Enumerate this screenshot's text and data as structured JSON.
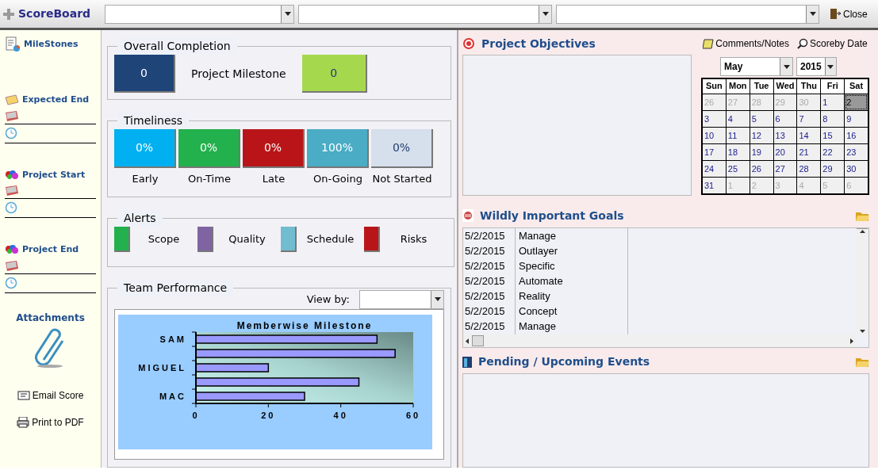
{
  "header": {
    "title": "ScoreBoard",
    "close": "Close"
  },
  "sidebar": {
    "heading": "MileStones",
    "sections": [
      {
        "label": "Expected End"
      },
      {
        "label": "Project Start"
      },
      {
        "label": "Project End"
      }
    ],
    "attachments": "Attachments",
    "actions": [
      {
        "kind": "email",
        "label": "Email Score"
      },
      {
        "kind": "print",
        "label": "Print to PDF"
      }
    ]
  },
  "overall": {
    "title": "Overall Completion",
    "value": "0",
    "milestone_label": "Project Milestone",
    "milestone_value": "0"
  },
  "timeliness": {
    "title": "Timeliness",
    "tiles": [
      {
        "value": "0%",
        "label": "Early",
        "color": "#00b0f0"
      },
      {
        "value": "0%",
        "label": "On-Time",
        "color": "#22b14c"
      },
      {
        "value": "0%",
        "label": "Late",
        "color": "#b91518"
      },
      {
        "value": "100%",
        "label": "On-Going",
        "color": "#4aacc5"
      },
      {
        "value": "0%",
        "label": "Not Started",
        "color": "#d6dfec"
      }
    ]
  },
  "alerts": {
    "title": "Alerts",
    "items": [
      {
        "label": "Scope",
        "color": "#22b14c"
      },
      {
        "label": "Quality",
        "color": "#8064a2"
      },
      {
        "label": "Schedule",
        "color": "#72bccf"
      },
      {
        "label": "Risks",
        "color": "#b91518"
      }
    ]
  },
  "team": {
    "title": "Team Performance",
    "view_by": "View by:",
    "chart_data": {
      "type": "bar",
      "orientation": "horizontal",
      "title": "Memberwise Milestone",
      "categories": [
        "SAM",
        null,
        "MIGUEL",
        null,
        "MAC"
      ],
      "series": [
        {
          "color": "#9999ff",
          "values": [
            50,
            55,
            20,
            45,
            30
          ]
        }
      ],
      "xlim": [
        0,
        60
      ],
      "xticks": [
        0,
        20,
        40,
        60
      ]
    }
  },
  "objectives": {
    "title": "Project Objectives",
    "links": [
      {
        "kind": "notes",
        "label": "Comments/Notes"
      },
      {
        "kind": "search",
        "label": "Scoreby Date"
      }
    ]
  },
  "calendar": {
    "month": "May",
    "year": "2015",
    "weekdays": [
      "Sun",
      "Mon",
      "Tue",
      "Wed",
      "Thu",
      "Fri",
      "Sat"
    ],
    "weeks": [
      [
        {
          "day": "26",
          "other": true,
          "selected": false
        },
        {
          "day": "27",
          "other": true,
          "selected": false
        },
        {
          "day": "28",
          "other": true,
          "selected": false
        },
        {
          "day": "29",
          "other": true,
          "selected": false
        },
        {
          "day": "30",
          "other": true,
          "selected": false
        },
        {
          "day": "1",
          "other": false,
          "selected": false
        },
        {
          "day": "2",
          "other": false,
          "selected": true
        }
      ],
      [
        {
          "day": "3",
          "other": false,
          "selected": false
        },
        {
          "day": "4",
          "other": false,
          "selected": false
        },
        {
          "day": "5",
          "other": false,
          "selected": false
        },
        {
          "day": "6",
          "other": false,
          "selected": false
        },
        {
          "day": "7",
          "other": false,
          "selected": false
        },
        {
          "day": "8",
          "other": false,
          "selected": false
        },
        {
          "day": "9",
          "other": false,
          "selected": false
        }
      ],
      [
        {
          "day": "10",
          "other": false,
          "selected": false
        },
        {
          "day": "11",
          "other": false,
          "selected": false
        },
        {
          "day": "12",
          "other": false,
          "selected": false
        },
        {
          "day": "13",
          "other": false,
          "selected": false
        },
        {
          "day": "14",
          "other": false,
          "selected": false
        },
        {
          "day": "15",
          "other": false,
          "selected": false
        },
        {
          "day": "16",
          "other": false,
          "selected": false
        }
      ],
      [
        {
          "day": "17",
          "other": false,
          "selected": false
        },
        {
          "day": "18",
          "other": false,
          "selected": false
        },
        {
          "day": "19",
          "other": false,
          "selected": false
        },
        {
          "day": "20",
          "other": false,
          "selected": false
        },
        {
          "day": "21",
          "other": false,
          "selected": false
        },
        {
          "day": "22",
          "other": false,
          "selected": false
        },
        {
          "day": "23",
          "other": false,
          "selected": false
        }
      ],
      [
        {
          "day": "24",
          "other": false,
          "selected": false
        },
        {
          "day": "25",
          "other": false,
          "selected": false
        },
        {
          "day": "26",
          "other": false,
          "selected": false
        },
        {
          "day": "27",
          "other": false,
          "selected": false
        },
        {
          "day": "28",
          "other": false,
          "selected": false
        },
        {
          "day": "29",
          "other": false,
          "selected": false
        },
        {
          "day": "30",
          "other": false,
          "selected": false
        }
      ],
      [
        {
          "day": "31",
          "other": false,
          "selected": false
        },
        {
          "day": "1",
          "other": true,
          "selected": false
        },
        {
          "day": "2",
          "other": true,
          "selected": false
        },
        {
          "day": "3",
          "other": true,
          "selected": false
        },
        {
          "day": "4",
          "other": true,
          "selected": false
        },
        {
          "day": "5",
          "other": true,
          "selected": false
        },
        {
          "day": "6",
          "other": true,
          "selected": false
        }
      ]
    ]
  },
  "goals": {
    "title": "Wildly Important Goals",
    "rows": [
      {
        "date": "5/2/2015",
        "goal": "Manage"
      },
      {
        "date": "5/2/2015",
        "goal": "Outlayer"
      },
      {
        "date": "5/2/2015",
        "goal": "Specific"
      },
      {
        "date": "5/2/2015",
        "goal": "Automate"
      },
      {
        "date": "5/2/2015",
        "goal": "Reality"
      },
      {
        "date": "5/2/2015",
        "goal": "Concept"
      },
      {
        "date": "5/2/2015",
        "goal": "Manage"
      }
    ]
  },
  "events": {
    "title": "Pending / Upcoming Events"
  }
}
